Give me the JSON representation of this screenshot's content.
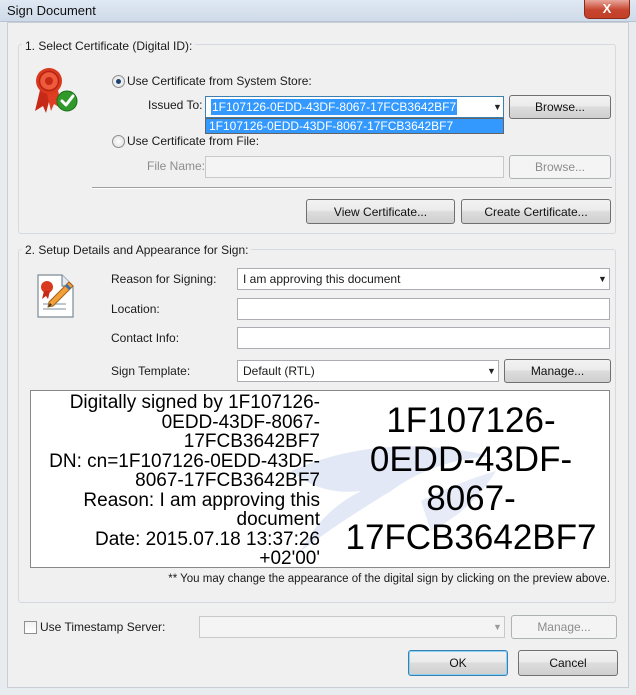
{
  "window": {
    "title": "Sign Document",
    "close_glyph": "X"
  },
  "certificate_group": {
    "legend": "1. Select Certificate (Digital ID):",
    "icon": "certificate-ribbon-check-icon",
    "radio_system_store": {
      "label": "Use Certificate from System Store:",
      "checked": true
    },
    "issued_to": {
      "label": "Issued To:",
      "value": "1F107126-0EDD-43DF-8067-17FCB3642BF7",
      "options": [
        "1F107126-0EDD-43DF-8067-17FCB3642BF7"
      ]
    },
    "browse_1": "Browse...",
    "radio_file": {
      "label": "Use Certificate from File:",
      "checked": false
    },
    "file_name": {
      "label": "File Name:",
      "value": ""
    },
    "browse_2": "Browse...",
    "view_certificate": "View Certificate...",
    "create_certificate": "Create Certificate..."
  },
  "setup_group": {
    "legend": "2. Setup Details and Appearance for Sign:",
    "icon": "document-signature-pen-icon",
    "reason": {
      "label": "Reason for Signing:",
      "value": "I am approving this document"
    },
    "location": {
      "label": "Location:",
      "value": ""
    },
    "contact": {
      "label": "Contact Info:",
      "value": ""
    },
    "template": {
      "label": "Sign Template:",
      "value": "Default (RTL)"
    },
    "manage": "Manage...",
    "preview": {
      "left_lines": [
        "Digitally signed by 1F107126-",
        "0EDD-43DF-8067-",
        "17FCB3642BF7",
        "DN: cn=1F107126-0EDD-43DF-",
        "8067-17FCB3642BF7",
        "Reason: I am approving this",
        "document",
        "Date: 2015.07.18 13:37:26",
        "+02'00'"
      ],
      "right_lines": [
        "1F107126-",
        "0EDD-43DF-",
        "8067-",
        "17FCB3642BF7"
      ]
    },
    "hint": "** You may change the appearance of the digital sign by clicking on the preview above."
  },
  "timestamp": {
    "label": "Use Timestamp Server:",
    "checked": false,
    "value": "",
    "manage": "Manage..."
  },
  "ok_label": "OK",
  "cancel_label": "Cancel",
  "colors": {
    "selection": "#3399ff",
    "accent_blue": "#3c7fb1",
    "close_red": "#c7452f"
  }
}
